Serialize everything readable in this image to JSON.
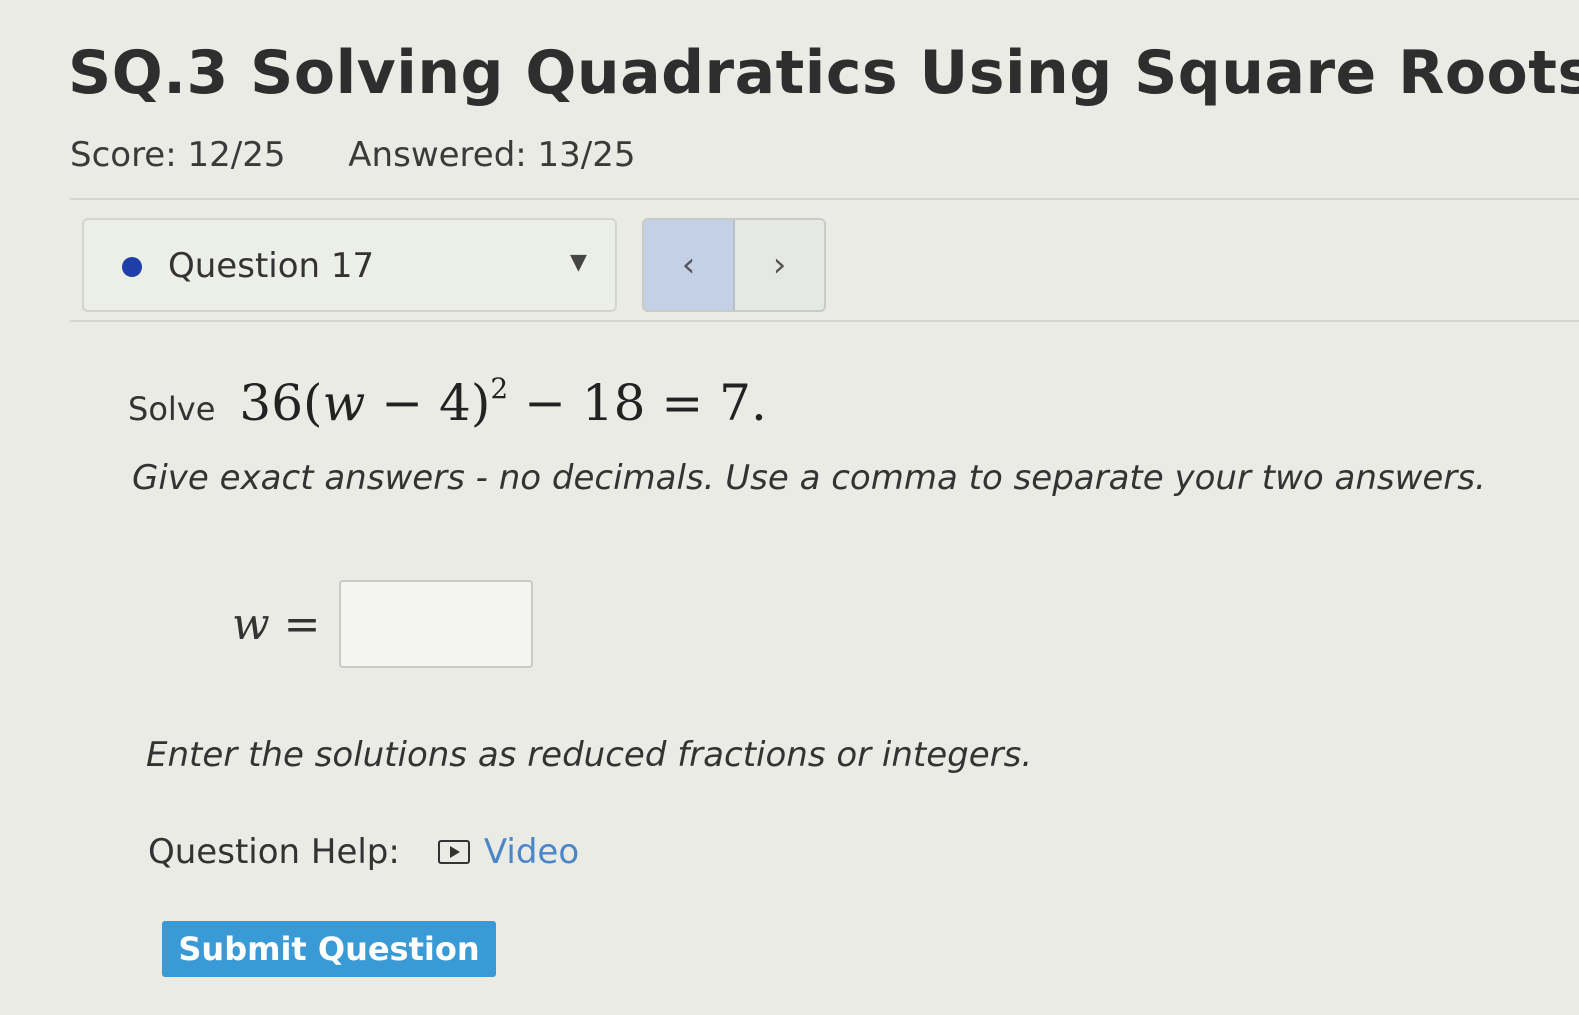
{
  "assignment": {
    "title": "SQ.3 Solving Quadratics Using Square Roots",
    "score": "Score: 12/25",
    "answered": "Answered: 13/25"
  },
  "question_nav": {
    "selected": "Question 17",
    "status_color": "#1f3fa8",
    "prev_label": "‹",
    "next_label": "›"
  },
  "problem": {
    "solve_word": "Solve",
    "equation": {
      "coefficient": "36",
      "open": "(",
      "variable": "w",
      "inner": " − 4)",
      "exponent": "2",
      "rest": " − 18 = 7",
      "period": "."
    },
    "instruction": "Give exact answers - no decimals. Use a comma to separate your two answers.",
    "answer_label": "w =",
    "answer_value": "",
    "hint": "Enter the solutions as reduced fractions or integers."
  },
  "help": {
    "label": "Question Help:",
    "video_icon": "video-icon",
    "video_label": "Video"
  },
  "submit_label": "Submit Question",
  "colors": {
    "submit_bg": "#3a9ad6",
    "link": "#4a86c8",
    "prev_bg": "#c3d0e6"
  }
}
